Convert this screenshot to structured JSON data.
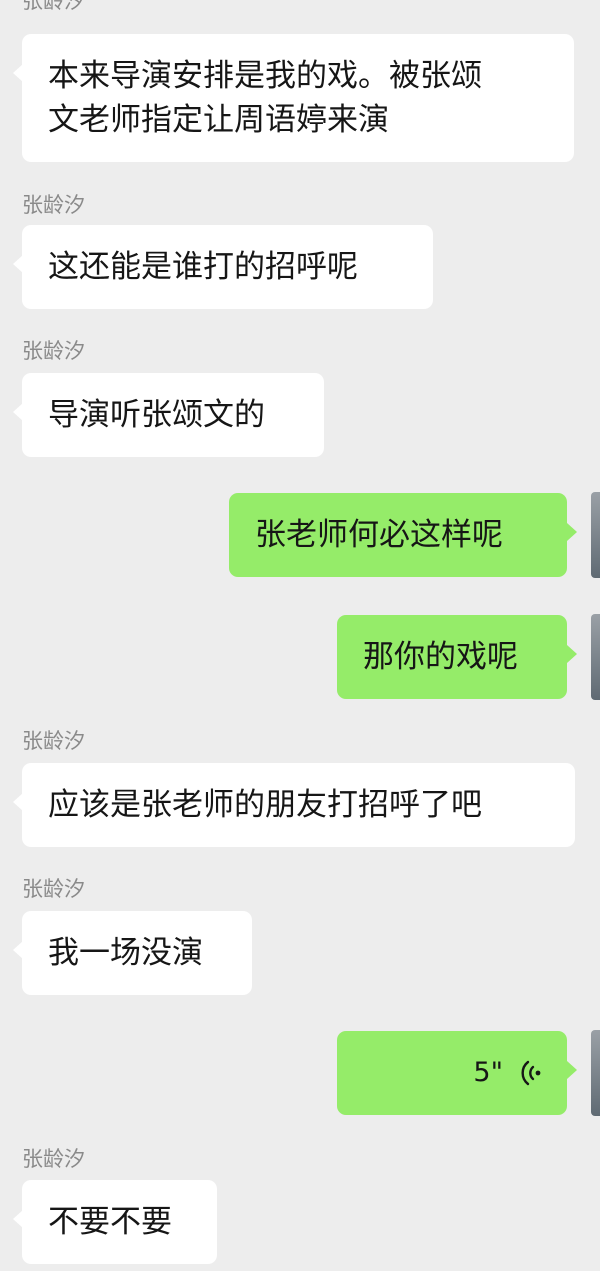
{
  "chat": {
    "messages": [
      {
        "type": "text",
        "direction": "incoming",
        "sender": "张龄汐",
        "lines": [
          "本来导演安排是我的戏。被张颂",
          "文老师指定让周语婷来演"
        ]
      },
      {
        "type": "text",
        "direction": "incoming",
        "sender": "张龄汐",
        "text": "这还能是谁打的招呼呢"
      },
      {
        "type": "text",
        "direction": "incoming",
        "sender": "张龄汐",
        "text": "导演听张颂文的"
      },
      {
        "type": "text",
        "direction": "outgoing",
        "text": "张老师何必这样呢"
      },
      {
        "type": "text",
        "direction": "outgoing",
        "text": "那你的戏呢"
      },
      {
        "type": "text",
        "direction": "incoming",
        "sender": "张龄汐",
        "text": "应该是张老师的朋友打招呼了吧"
      },
      {
        "type": "text",
        "direction": "incoming",
        "sender": "张龄汐",
        "text": "我一场没演"
      },
      {
        "type": "voice",
        "direction": "outgoing",
        "duration": "5\"",
        "icon": "voice-wave-icon"
      },
      {
        "type": "text",
        "direction": "incoming",
        "sender": "张龄汐",
        "text": "不要不要"
      }
    ]
  },
  "colors": {
    "background": "#ededed",
    "incoming_bubble": "#ffffff",
    "outgoing_bubble": "#95ec69",
    "sender_name": "#8a8a8a"
  }
}
